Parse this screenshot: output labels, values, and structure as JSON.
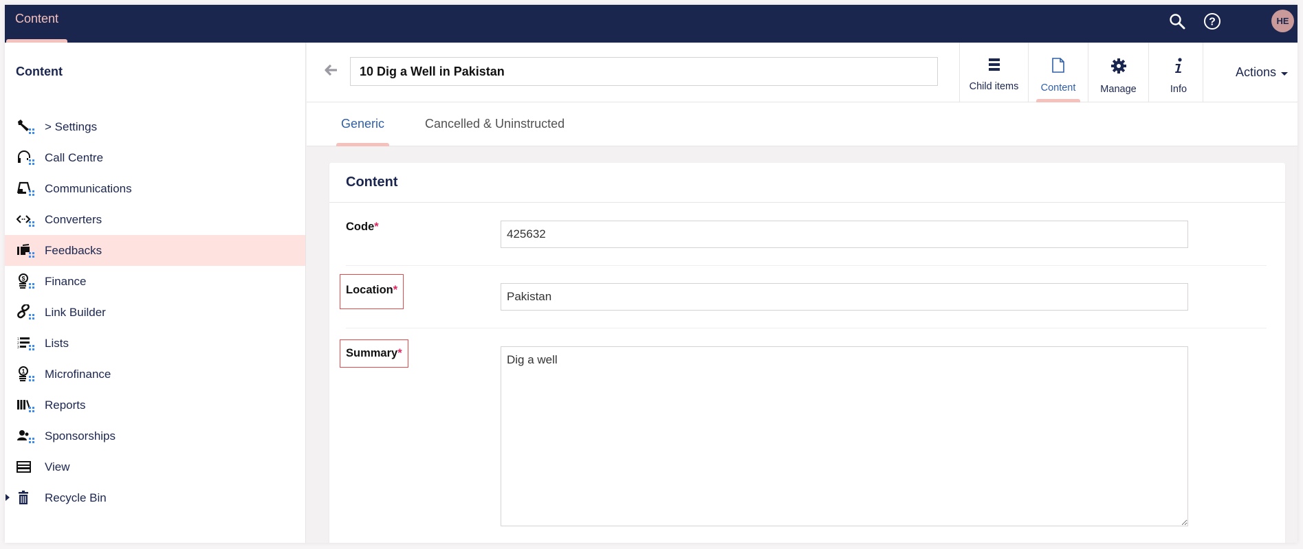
{
  "topbar": {
    "section": "Content",
    "search_icon": "search-icon",
    "help_icon": "help-icon",
    "avatar_initials": "HE"
  },
  "sidebar": {
    "title": "Content",
    "items": [
      {
        "label": "> Settings",
        "icon": "wrench-icon",
        "active": false
      },
      {
        "label": "Call Centre",
        "icon": "headset-icon",
        "active": false
      },
      {
        "label": "Communications",
        "icon": "inbox-icon",
        "active": false
      },
      {
        "label": "Converters",
        "icon": "code-arrows-icon",
        "active": false
      },
      {
        "label": "Feedbacks",
        "icon": "feedback-icon",
        "active": true
      },
      {
        "label": "Finance",
        "icon": "coins-icon",
        "active": false
      },
      {
        "label": "Link Builder",
        "icon": "link-icon",
        "active": false
      },
      {
        "label": "Lists",
        "icon": "numbered-list-icon",
        "active": false
      },
      {
        "label": "Microfinance",
        "icon": "coin-stack-icon",
        "active": false
      },
      {
        "label": "Reports",
        "icon": "books-icon",
        "active": false
      },
      {
        "label": "Sponsorships",
        "icon": "users-icon",
        "active": false
      },
      {
        "label": "View",
        "icon": "window-icon",
        "active": false
      },
      {
        "label": "Recycle Bin",
        "icon": "trash-icon",
        "active": false
      }
    ]
  },
  "header": {
    "name_value": "10 Dig a Well in Pakistan",
    "apps": [
      {
        "label": "Child items",
        "icon": "list-icon",
        "active": false
      },
      {
        "label": "Content",
        "icon": "document-icon",
        "active": true
      },
      {
        "label": "Manage",
        "icon": "gear-icon",
        "active": false
      },
      {
        "label": "Info",
        "icon": "info-icon",
        "active": false
      }
    ],
    "actions_label": "Actions"
  },
  "tabs": [
    {
      "label": "Generic",
      "active": true
    },
    {
      "label": "Cancelled & Uninstructed",
      "active": false
    }
  ],
  "card": {
    "title": "Content",
    "fields": [
      {
        "label": "Code",
        "required_mark": "*",
        "value": "425632"
      },
      {
        "label": "Location",
        "required_mark": "*",
        "value": "Pakistan"
      },
      {
        "label": "Summary",
        "required_mark": "*",
        "value": "Dig a well"
      }
    ]
  },
  "colors": {
    "topbar": "#1b264f",
    "accent_pink": "#f5c1bc",
    "active_row": "#fde2df",
    "active_blue": "#2f5ea8",
    "required": "#e0245e",
    "highlight_box": "#e04a4a"
  }
}
